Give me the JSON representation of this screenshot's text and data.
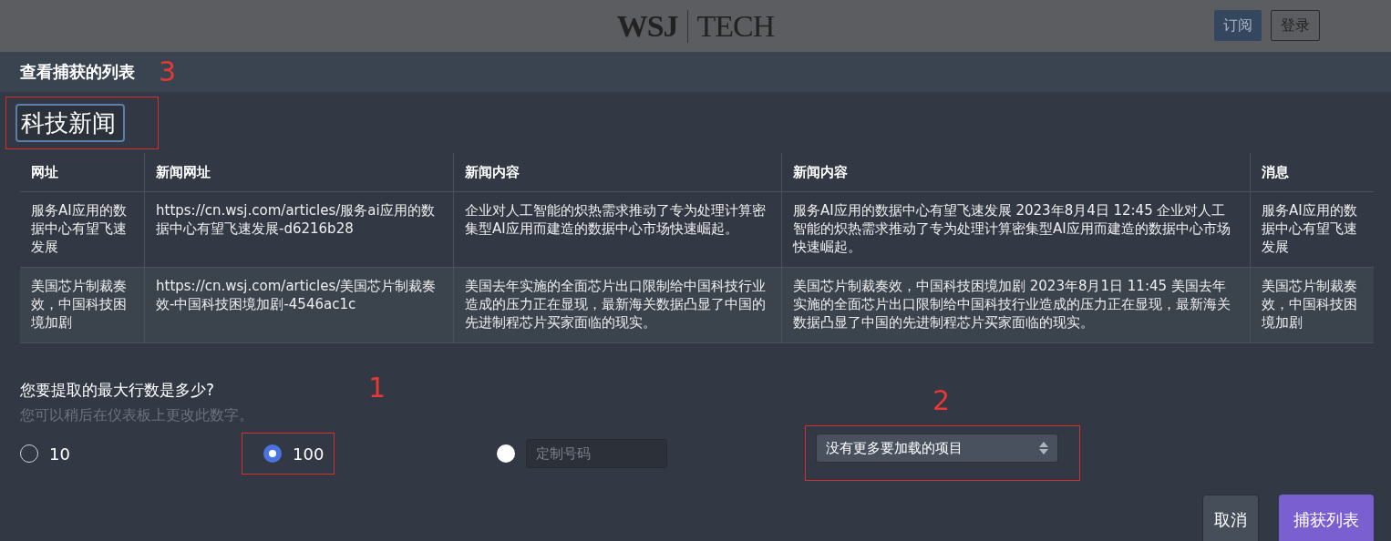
{
  "site_header": {
    "logo": [
      "WSJ",
      "TECH"
    ],
    "buttons": [
      {
        "label": "订阅",
        "kind": "filled"
      },
      {
        "label": "登录",
        "kind": "outline"
      }
    ]
  },
  "dialog": {
    "title": "查看捕获的列表",
    "marker": "3",
    "list_name": {
      "value": "科技新闻",
      "highlighted": true
    },
    "table": {
      "columns": [
        "网址",
        "新闻网址",
        "新闻内容",
        "新闻内容",
        "消息"
      ],
      "rows": [
        [
          "服务AI应用的数据中心有望飞速发展",
          "https://cn.wsj.com/articles/服务ai应用的数据中心有望飞速发展-d6216b28",
          "企业对人工智能的炽热需求推动了专为处理计算密集型AI应用而建造的数据中心市场快速崛起。",
          "服务AI应用的数据中心有望飞速发展 2023年8月4日 12:45 企业对人工智能的炽热需求推动了专为处理计算密集型AI应用而建造的数据中心市场快速崛起。",
          "服务AI应用的数据中心有望飞速发展"
        ],
        [
          "美国芯片制裁奏效，中国科技困境加剧",
          "https://cn.wsj.com/articles/美国芯片制裁奏效-中国科技困境加剧-4546ac1c",
          "美国去年实施的全面芯片出口限制给中国科技行业造成的压力正在显现，最新海关数据凸显了中国的先进制程芯片买家面临的现实。",
          "美国芯片制裁奏效，中国科技困境加剧 2023年8月1日 11:45 美国去年实施的全面芯片出口限制给中国科技行业造成的压力正在显现，最新海关数据凸显了中国的先进制程芯片买家面临的现实。",
          "美国芯片制裁奏效，中国科技困境加剧"
        ]
      ]
    },
    "max_rows": {
      "question": "您要提取的最大行数是多少?",
      "hint": "您可以稍后在仪表板上更改此数字。",
      "marker": "1",
      "options": [
        {
          "kind": "preset",
          "label": "10",
          "selected": false,
          "highlighted": false
        },
        {
          "kind": "preset",
          "label": "100",
          "selected": true,
          "highlighted": true
        },
        {
          "kind": "custom",
          "placeholder": "定制号码",
          "selected": false,
          "highlighted": false
        }
      ]
    },
    "load_select": {
      "value": "没有更多要加载的项目",
      "highlighted": true,
      "marker": "2"
    },
    "buttons": [
      {
        "label": "取消",
        "kind": "secondary"
      },
      {
        "label": "捕获列表",
        "kind": "primary"
      }
    ]
  }
}
